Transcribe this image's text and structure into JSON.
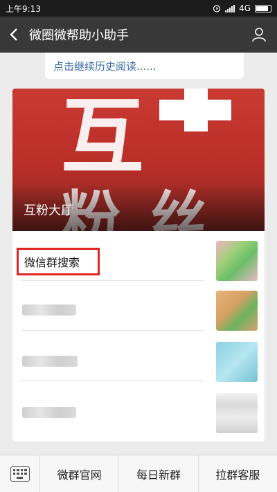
{
  "status_bar": {
    "time": "上午9:13",
    "network": "4G"
  },
  "header": {
    "title": "微圈微帮助小助手",
    "back_icon": "chevron-left-icon",
    "profile_icon": "person-icon"
  },
  "history": {
    "text": "点击继续历史阅读......"
  },
  "banner": {
    "big_text_1": "互",
    "big_text_2": "粉丝",
    "label": "互粉大厅"
  },
  "list": {
    "items": [
      {
        "label": "微信群搜索"
      }
    ]
  },
  "bottom_menu": {
    "keyboard_icon": "keyboard-icon",
    "items": [
      {
        "label": "微群官网"
      },
      {
        "label": "每日新群"
      },
      {
        "label": "拉群客服"
      }
    ]
  },
  "colors": {
    "header_bg": "#383838",
    "link": "#3b6ea5",
    "highlight": "#e02323",
    "banner_red": "#c93a33"
  }
}
